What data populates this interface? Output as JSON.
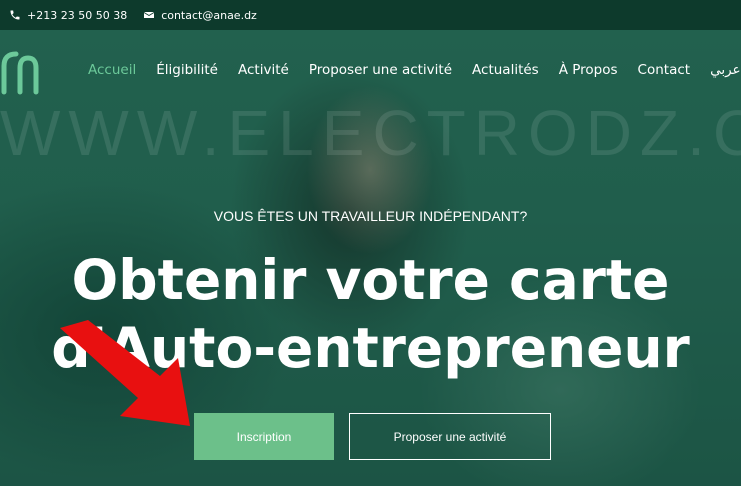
{
  "topbar": {
    "phone": "+213 23 50 50 38",
    "email": "contact@anae.dz",
    "phone_icon": "phone-icon",
    "email_icon": "mail-icon"
  },
  "nav": {
    "items": [
      {
        "label": "Accueil",
        "active": true
      },
      {
        "label": "Éligibilité"
      },
      {
        "label": "Activité"
      },
      {
        "label": "Proposer une activité"
      },
      {
        "label": "Actualités"
      },
      {
        "label": "À Propos"
      },
      {
        "label": "Contact"
      },
      {
        "label": "عربي"
      }
    ]
  },
  "watermark": "WWW.ELECTRODZ.COM",
  "hero": {
    "kicker": "VOUS ÊTES UN TRAVAILLEUR INDÉPENDANT?",
    "headline_line1": "Obtenir votre carte",
    "headline_line2": "d'Auto-entrepreneur",
    "primary_button": "Inscription",
    "secondary_button": "Proposer une activité"
  },
  "colors": {
    "accent": "#6cc08a",
    "topbar": "#0d3a2c",
    "arrow": "#e81010"
  }
}
